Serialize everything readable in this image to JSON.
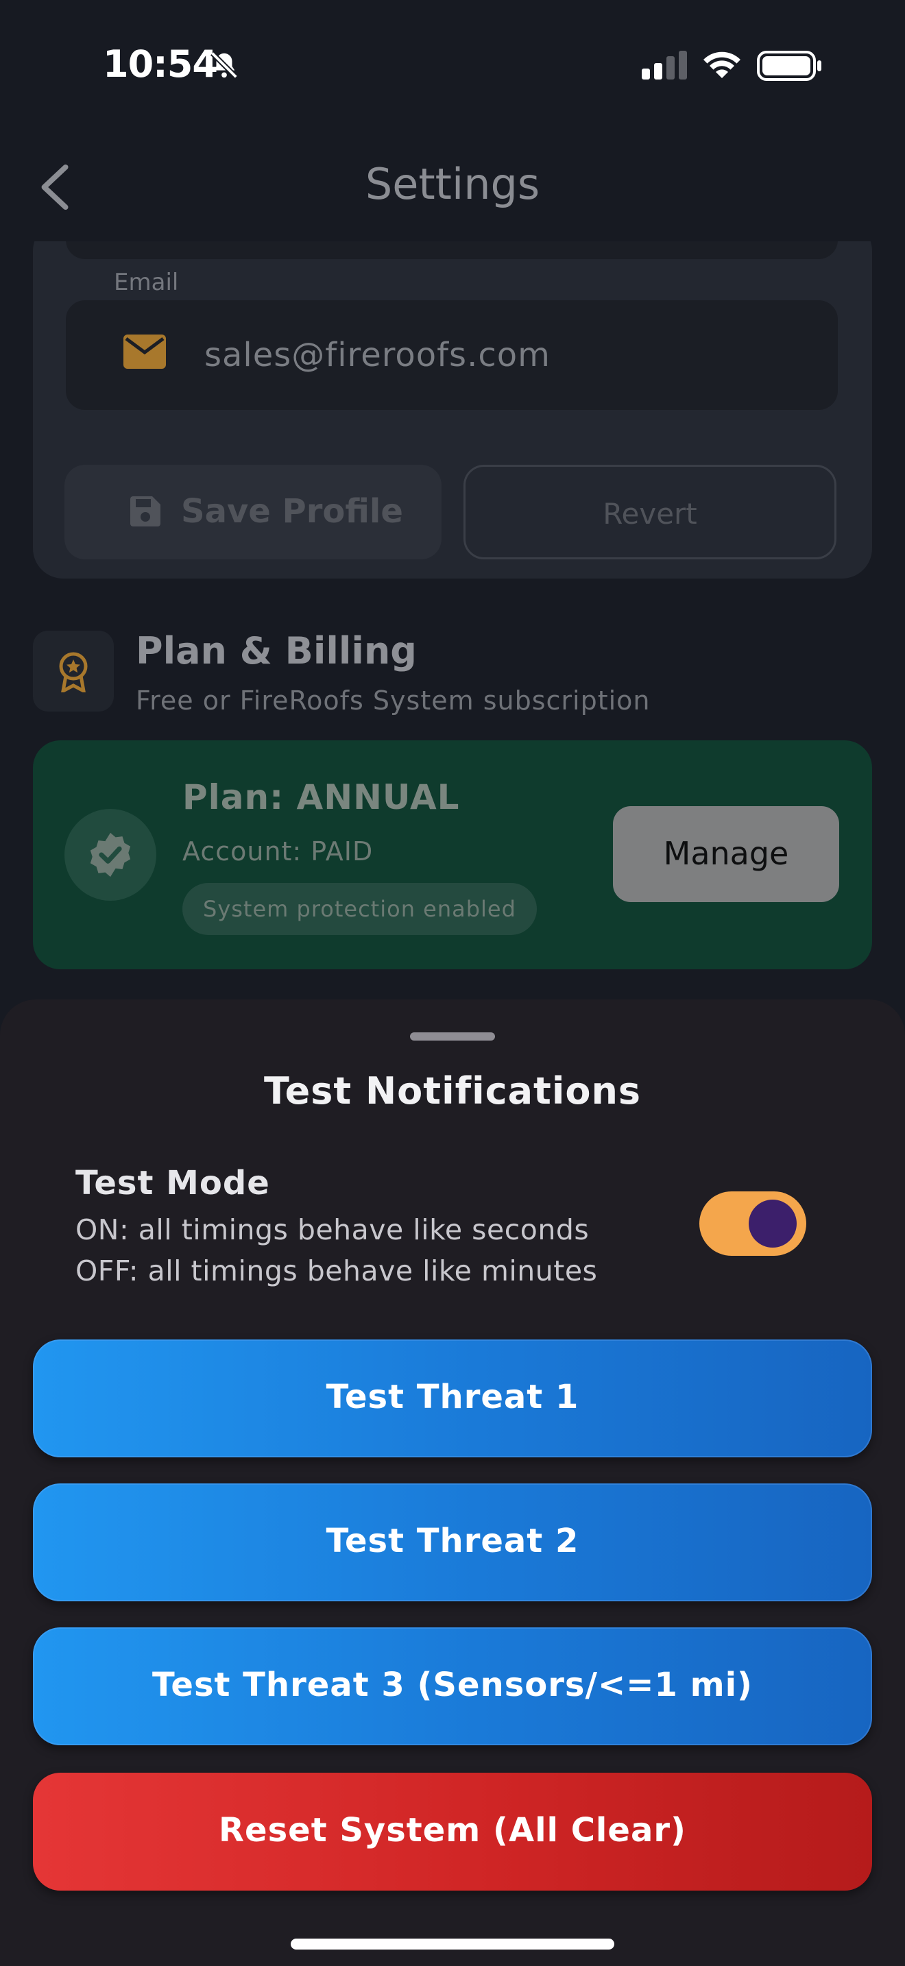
{
  "status_bar": {
    "time": "10:54",
    "icons": [
      "bell-slash-icon",
      "cellular-signal-icon",
      "wifi-icon",
      "battery-icon"
    ]
  },
  "nav": {
    "title": "Settings",
    "back_icon": "chevron-left-icon"
  },
  "profile": {
    "email_label": "Email",
    "email_value": "sales@fireroofs.com",
    "email_icon": "envelope-icon",
    "save_label": "Save Profile",
    "save_icon": "floppy-disk-icon",
    "revert_label": "Revert"
  },
  "plan_billing": {
    "heading": "Plan & Billing",
    "subtitle": "Free or FireRoofs System subscription",
    "icon": "award-ribbon-icon",
    "plan_name": "Plan: ANNUAL",
    "account": "Account: PAID",
    "pill": "System protection enabled",
    "badge_icon": "verified-badge-icon",
    "manage_label": "Manage"
  },
  "sheet": {
    "title": "Test Notifications",
    "mode_title": "Test Mode",
    "mode_on_text": "ON: all timings behave like seconds",
    "mode_off_text": "OFF: all timings behave like minutes",
    "toggle_on": true,
    "buttons": [
      {
        "label": "Test Threat 1"
      },
      {
        "label": "Test Threat 2"
      },
      {
        "label": "Test Threat 3 (Sensors/<=1 mi)"
      }
    ],
    "reset_label": "Reset System (All Clear)"
  },
  "colors": {
    "accent_blue": "#1a79d7",
    "danger_red": "#cf2525",
    "toggle_track": "#f4a64c",
    "toggle_knob": "#3c1f6b",
    "plan_card": "#0f3b2d"
  }
}
